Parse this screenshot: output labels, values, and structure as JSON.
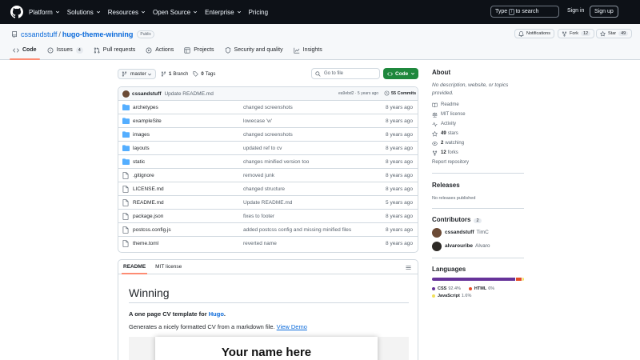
{
  "header": {
    "nav": [
      {
        "label": "Platform",
        "dropdown": true
      },
      {
        "label": "Solutions",
        "dropdown": true
      },
      {
        "label": "Resources",
        "dropdown": true
      },
      {
        "label": "Open Source",
        "dropdown": true
      },
      {
        "label": "Enterprise",
        "dropdown": true
      },
      {
        "label": "Pricing",
        "dropdown": false
      }
    ],
    "search_pre": "Type",
    "search_key": "/",
    "search_post": "to search",
    "signin": "Sign in",
    "signup": "Sign up"
  },
  "repo": {
    "owner": "cssandstuff",
    "separator": "/",
    "name": "hugo-theme-winning",
    "visibility": "Public",
    "notifications": "Notifications",
    "fork_label": "Fork",
    "fork_count": "12",
    "star_label": "Star",
    "star_count": "49"
  },
  "tabs": [
    {
      "label": "Code",
      "icon": "code-icon",
      "count": "",
      "active": true
    },
    {
      "label": "Issues",
      "icon": "issue-icon",
      "count": "4",
      "active": false
    },
    {
      "label": "Pull requests",
      "icon": "pull-request-icon",
      "count": "",
      "active": false
    },
    {
      "label": "Actions",
      "icon": "play-icon",
      "count": "",
      "active": false
    },
    {
      "label": "Projects",
      "icon": "table-icon",
      "count": "",
      "active": false
    },
    {
      "label": "Security and quality",
      "icon": "shield-icon",
      "count": "",
      "active": false
    },
    {
      "label": "Insights",
      "icon": "graph-icon",
      "count": "",
      "active": false
    }
  ],
  "filenav": {
    "branch": "master",
    "branches_count": "1",
    "branches_label": "Branch",
    "tags_count": "0",
    "tags_label": "Tags",
    "goto_placeholder": "Go to file",
    "code_button": "Code"
  },
  "last_commit": {
    "author": "cssandstuff",
    "message": "Update README.md",
    "sha": "ea9ebd2",
    "dot": "·",
    "age": "5 years ago",
    "commits_count": "55",
    "commits_label": "Commits"
  },
  "files": [
    {
      "type": "folder",
      "name": "archetypes",
      "message": "changed screenshots",
      "age": "8 years ago"
    },
    {
      "type": "folder",
      "name": "exampleSite",
      "message": "lowecase 'w'",
      "age": "8 years ago"
    },
    {
      "type": "folder",
      "name": "images",
      "message": "changed screenshots",
      "age": "8 years ago"
    },
    {
      "type": "folder",
      "name": "layouts",
      "message": "updated ref to cv",
      "age": "8 years ago"
    },
    {
      "type": "folder",
      "name": "static",
      "message": "changes minified version too",
      "age": "8 years ago"
    },
    {
      "type": "file",
      "name": ".gitignore",
      "message": "removed junk",
      "age": "8 years ago"
    },
    {
      "type": "file",
      "name": "LICENSE.md",
      "message": "changed structure",
      "age": "8 years ago"
    },
    {
      "type": "file",
      "name": "README.md",
      "message": "Update README.md",
      "age": "5 years ago"
    },
    {
      "type": "file",
      "name": "package.json",
      "message": "fixes to footer",
      "age": "8 years ago"
    },
    {
      "type": "file",
      "name": "postcss.config.js",
      "message": "added postcss config and missing minified files",
      "age": "8 years ago"
    },
    {
      "type": "file",
      "name": "theme.toml",
      "message": "reverted name",
      "age": "8 years ago"
    }
  ],
  "readme": {
    "tab_readme": "README",
    "tab_license": "MIT license",
    "title": "Winning",
    "intro_pre": "A one page CV template for ",
    "intro_link": "Hugo",
    "intro_post": ".",
    "desc_pre": "Generates a nicely formatted CV from a markdown file. ",
    "desc_link": "View Demo",
    "preview_heading": "Your name here"
  },
  "about": {
    "title": "About",
    "description": "No description, website, or topics provided.",
    "readme": "Readme",
    "license": "MIT license",
    "activity": "Activity",
    "stars_count": "49",
    "stars_label": "stars",
    "watching_count": "2",
    "watching_label": "watching",
    "forks_count": "12",
    "forks_label": "forks",
    "report": "Report repository"
  },
  "releases": {
    "title": "Releases",
    "empty": "No releases published"
  },
  "contributors": {
    "title": "Contributors",
    "count": "2",
    "people": [
      {
        "login": "cssandstuff",
        "name": "TimC",
        "avatar_color": "#6b4a35"
      },
      {
        "login": "alvarouribe",
        "name": "Alvaro",
        "avatar_color": "#2d2a26"
      }
    ]
  },
  "languages": {
    "title": "Languages",
    "items": [
      {
        "name": "CSS",
        "percent": "92.4%",
        "value": 92.4,
        "color": "#663399"
      },
      {
        "name": "HTML",
        "percent": "6%",
        "value": 6.0,
        "color": "#e34c26"
      },
      {
        "name": "JavaScript",
        "percent": "1.6%",
        "value": 1.6,
        "color": "#f1e05a"
      }
    ]
  }
}
